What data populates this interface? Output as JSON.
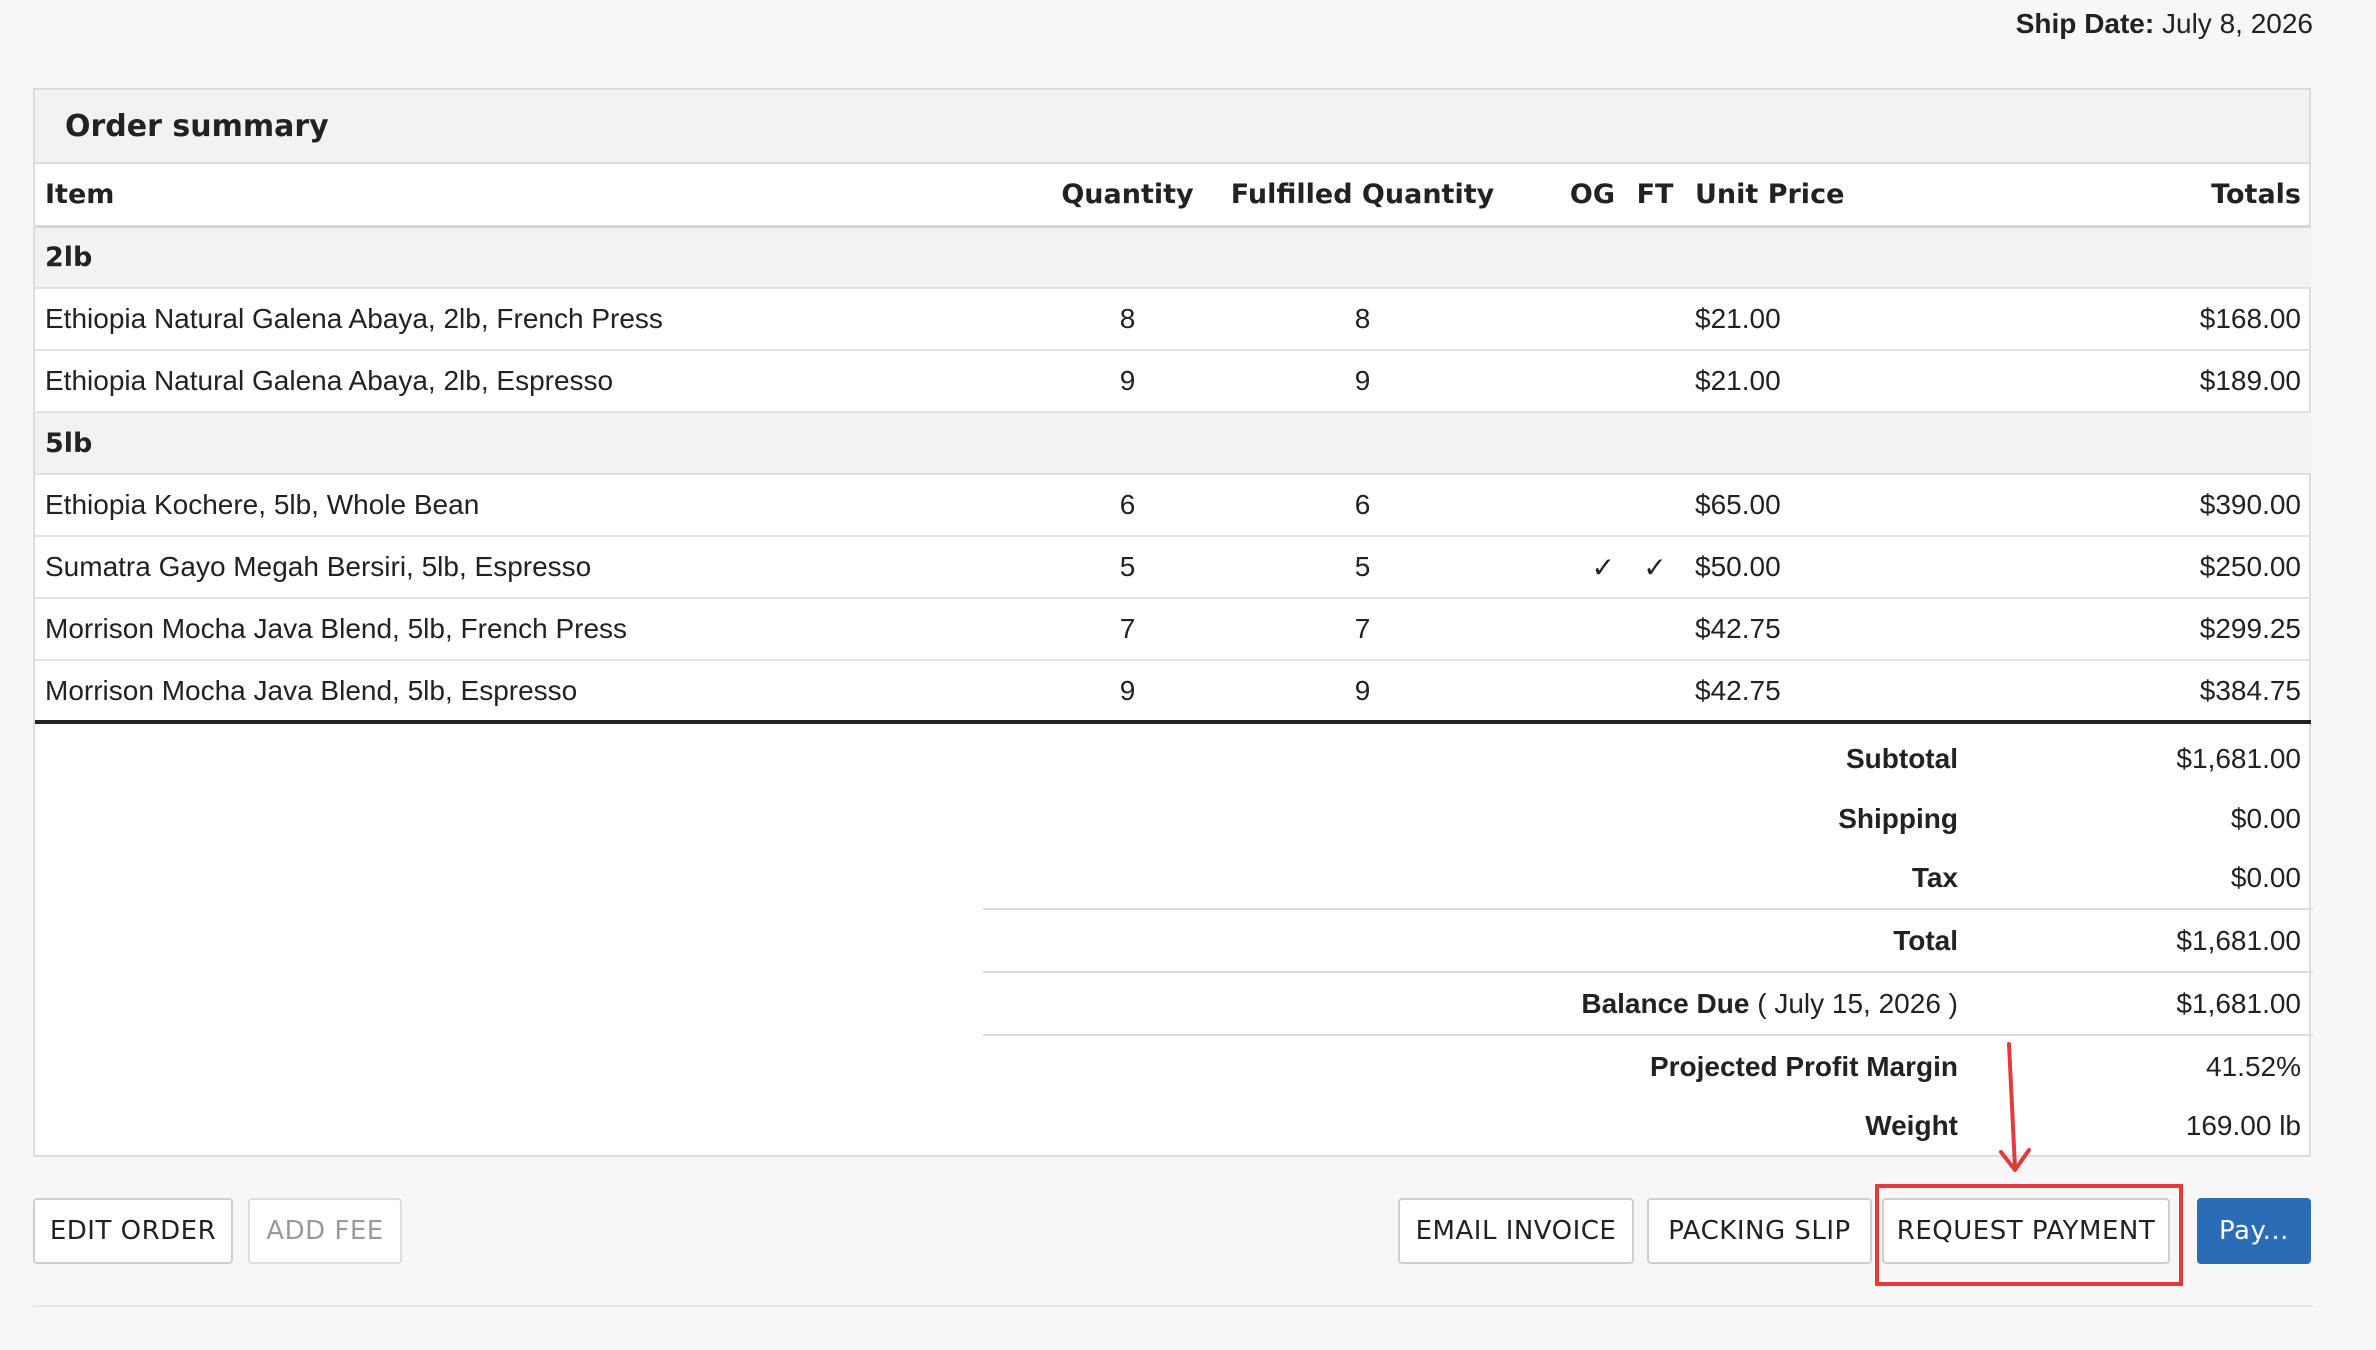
{
  "header": {
    "ship_date_label": "Ship Date:",
    "ship_date_value": "July 8, 2026"
  },
  "order_summary": {
    "title": "Order summary",
    "columns": [
      "Item",
      "Quantity",
      "Fulfilled Quantity",
      "OG",
      "FT",
      "Unit Price",
      "Totals"
    ],
    "groups": [
      {
        "name": "2lb",
        "rows": [
          {
            "item": "Ethiopia Natural Galena Abaya, 2lb, French Press",
            "qty": "8",
            "fulfilled": "8",
            "og": "",
            "ft": "",
            "unit_price": "$21.00",
            "total": "$168.00"
          },
          {
            "item": "Ethiopia Natural Galena Abaya, 2lb, Espresso",
            "qty": "9",
            "fulfilled": "9",
            "og": "",
            "ft": "",
            "unit_price": "$21.00",
            "total": "$189.00"
          }
        ]
      },
      {
        "name": "5lb",
        "rows": [
          {
            "item": "Ethiopia Kochere, 5lb, Whole Bean",
            "qty": "6",
            "fulfilled": "6",
            "og": "",
            "ft": "",
            "unit_price": "$65.00",
            "total": "$390.00"
          },
          {
            "item": "Sumatra Gayo Megah Bersiri, 5lb, Espresso",
            "qty": "5",
            "fulfilled": "5",
            "og": "✓",
            "ft": "✓",
            "unit_price": "$50.00",
            "total": "$250.00"
          },
          {
            "item": "Morrison Mocha Java Blend, 5lb, French Press",
            "qty": "7",
            "fulfilled": "7",
            "og": "",
            "ft": "",
            "unit_price": "$42.75",
            "total": "$299.25"
          },
          {
            "item": "Morrison Mocha Java Blend, 5lb, Espresso",
            "qty": "9",
            "fulfilled": "9",
            "og": "",
            "ft": "",
            "unit_price": "$42.75",
            "total": "$384.75"
          }
        ]
      }
    ],
    "totals": {
      "subtotal_label": "Subtotal",
      "subtotal": "$1,681.00",
      "shipping_label": "Shipping",
      "shipping": "$0.00",
      "tax_label": "Tax",
      "tax": "$0.00",
      "total_label": "Total",
      "total": "$1,681.00",
      "balance_label": "Balance Due",
      "balance_date": " ( July 15, 2026 )",
      "balance": "$1,681.00",
      "margin_label": "Projected Profit Margin",
      "margin": "41.52%",
      "weight_label": "Weight",
      "weight": "169.00 lb"
    }
  },
  "actions": {
    "edit_order": "EDIT ORDER",
    "add_fee": "ADD FEE",
    "email_invoice": "EMAIL INVOICE",
    "packing_slip": "PACKING SLIP",
    "request_payment": "REQUEST PAYMENT",
    "pay": "Pay..."
  },
  "annotation_color": "#e23b3b",
  "primary_color": "#2a6db6"
}
